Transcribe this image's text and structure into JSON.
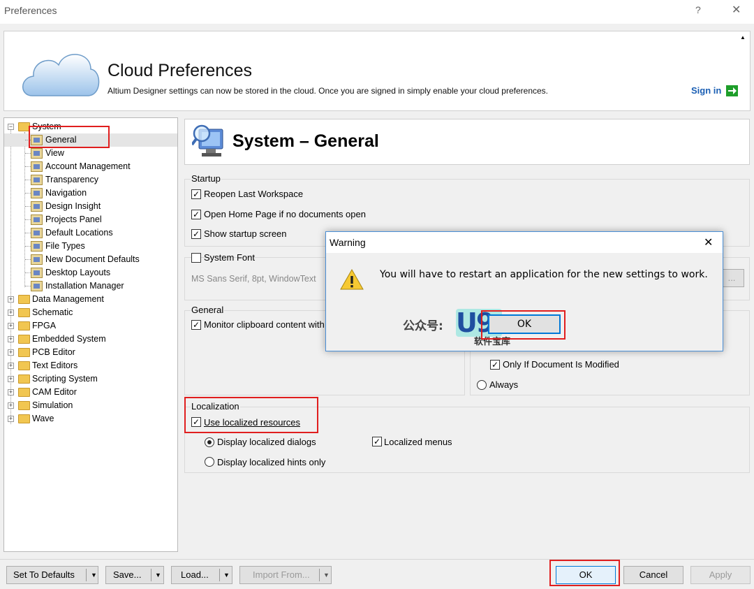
{
  "window": {
    "title": "Preferences",
    "help": "?",
    "close": "✕"
  },
  "cloud": {
    "title": "Cloud Preferences",
    "description": "Altium Designer settings can now be stored in the cloud. Once you are signed in simply enable your cloud preferences.",
    "signin": "Sign in"
  },
  "tree": {
    "system": "System",
    "children": [
      "General",
      "View",
      "Account Management",
      "Transparency",
      "Navigation",
      "Design Insight",
      "Projects Panel",
      "Default Locations",
      "File Types",
      "New Document Defaults",
      "Desktop Layouts",
      "Installation Manager"
    ],
    "roots": [
      "Data Management",
      "Schematic",
      "FPGA",
      "Embedded System",
      "PCB Editor",
      "Text Editors",
      "Scripting System",
      "CAM Editor",
      "Simulation",
      "Wave"
    ]
  },
  "page": {
    "title": "System – General",
    "startup": {
      "label": "Startup",
      "reopen": "Reopen Last Workspace",
      "homepage": "Open Home Page if no documents open",
      "splash": "Show startup screen"
    },
    "font": {
      "label": "System Font",
      "value": "MS Sans Serif, 8pt, WindowText",
      "change": "..."
    },
    "general": {
      "label": "General",
      "clipboard": "Monitor clipboard content with"
    },
    "autosave": {
      "only_modified": "Only If Document Is Modified",
      "always": "Always"
    },
    "localization": {
      "label": "Localization",
      "use": "Use localized resources",
      "dialogs": "Display localized dialogs",
      "hints": "Display localized hints only",
      "menus": "Localized menus"
    }
  },
  "dialog": {
    "title": "Warning",
    "message": "You will have to restart an application for the new settings to work.",
    "ok": "OK",
    "close": "✕"
  },
  "watermark": {
    "text1": "公众号:",
    "text2": "U9",
    "text3": "软件宝库"
  },
  "footer": {
    "defaults": "Set To Defaults",
    "save": "Save...",
    "load": "Load...",
    "import": "Import From...",
    "ok": "OK",
    "cancel": "Cancel",
    "apply": "Apply"
  }
}
